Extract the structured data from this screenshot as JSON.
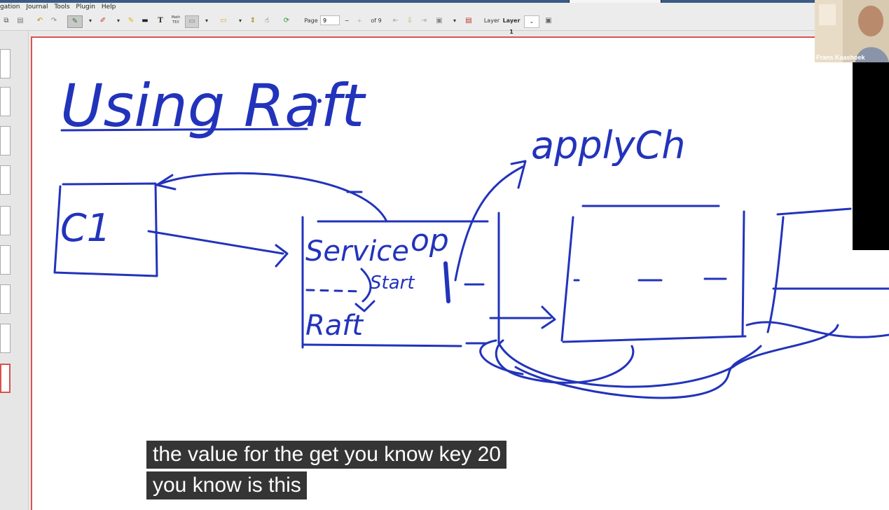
{
  "menu": {
    "items": [
      "gation",
      "Journal",
      "Tools",
      "Plugin",
      "Help"
    ]
  },
  "toolbar": {
    "page_label": "Page",
    "page_value": "9",
    "page_total": "of 9",
    "layer_label": "Layer",
    "layer_value": "Layer 1",
    "math_label": "Math\nTEX",
    "text_tool": "T"
  },
  "webcam": {
    "name": "Frans Kaashoek"
  },
  "drawing": {
    "title": "Using Raft",
    "client_label": "C1",
    "service_label": "Service",
    "op_label": "op",
    "start_label": "Start",
    "raft_label": "Raft",
    "applych_label": "applyCh"
  },
  "captions": {
    "line1": "the value for the get you know key 20",
    "line2": "you know is this"
  },
  "colors": {
    "ink": "#2233bb",
    "accent_border": "#d9534f"
  }
}
